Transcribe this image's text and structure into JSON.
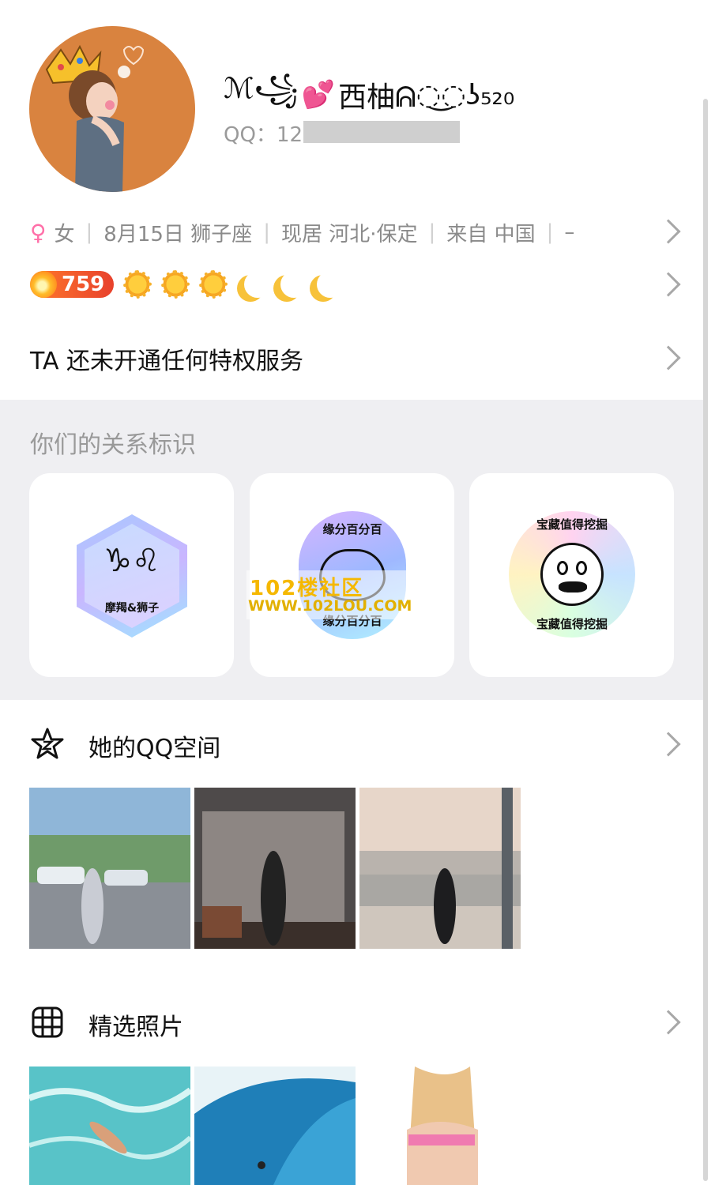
{
  "profile": {
    "nickname_prefix": "ℳ꧁",
    "nickname_heart": "💕",
    "nickname_main": "西柚ᕱ",
    "nickname_suffix": "◌͜◌ʖ₅₂₀",
    "qq_label": "QQ：",
    "qq_visible": "12"
  },
  "info": {
    "gender_symbol": "♀",
    "gender": "女",
    "birthday": "8月15日",
    "zodiac": "狮子座",
    "location_label": "现居",
    "location": "河北·保定",
    "from_label": "来自",
    "from": "中国",
    "extra": "–"
  },
  "level": {
    "value": "759",
    "suns": 3,
    "moons": 3
  },
  "privilege_text": "TA 还未开通任何特权服务",
  "relations": {
    "title": "你们的关系标识",
    "badges": [
      {
        "zodiac_glyphs": "♑♌",
        "label": "摩羯&狮子"
      },
      {
        "top_text": "缘分百分百",
        "bottom_text": "缘分百分百"
      },
      {
        "top_text": "宝藏值得挖掘",
        "side_text": "宝藏值得挖掘"
      }
    ]
  },
  "watermark": {
    "line1": "102楼社区",
    "line2": "WWW.102LOU.COM"
  },
  "qzone": {
    "title": "她的QQ空间"
  },
  "photos": {
    "title": "精选照片"
  },
  "colors": {
    "accent_female": "#ff6fa8",
    "level_badge": "#e8412c",
    "section_bg": "#efeff2"
  }
}
